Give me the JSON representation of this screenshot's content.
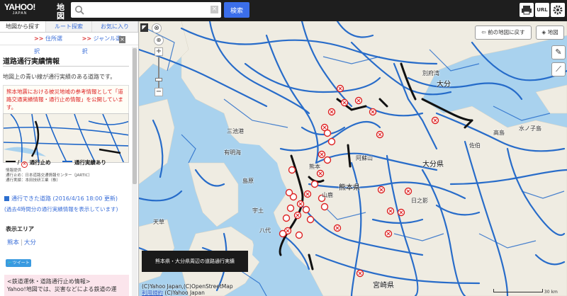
{
  "app": {
    "logo": "YAHOO!",
    "logo_sub": "JAPAN",
    "logo_service": "地図"
  },
  "search": {
    "value": "",
    "placeholder": "",
    "button_label": "検索"
  },
  "topbar_icons": [
    "print-icon",
    "url-icon",
    "settings-icon"
  ],
  "topbar_url_label": "URL",
  "tabs": [
    {
      "label": "地図から探す",
      "active": true
    },
    {
      "label": "ルート探索",
      "active": false
    },
    {
      "label": "お気に入り",
      "active": false
    }
  ],
  "subnav": {
    "arrow": ">>",
    "address": "住所選択",
    "genre": "ジャンル選択",
    "close": "×"
  },
  "panel": {
    "title": "道路通行実績情報",
    "intro": "地図上の青い線が通行実績のある道路です。",
    "notice": "熊本地震における被災地域の参考情報として「道路交通実績情報・通行止め情報」を公開しています。",
    "legend_closed": "通行止め",
    "legend_passable": "通行実績あり",
    "legend_slash": "/",
    "credits_header": "情報提供",
    "credits_closed": "通行止め：日本道路交通情報センター（JARTIC）",
    "credits_passable": "通行実績：本田技研工業（株）",
    "passable_link": "通行できた道路 (2016/4/16 18:00 更新)",
    "passable_sub": "(過去4時間分の通行実績情報を表示しています)",
    "area_label": "表示エリア",
    "areas": [
      "熊本",
      "大分"
    ],
    "tweet": "ツイート",
    "rail_title": "<鉄道運休・道路通行止め情報>",
    "rail_text": "Yahoo!地図では、災害などによる鉄道の運"
  },
  "map": {
    "prev_map": "前の地図に戻す",
    "layers": "地図",
    "zoom_in": "+",
    "zoom_out": "−",
    "caption": "熊本県・大分県周辺の道路通行実績",
    "copyright": "(C)Yahoo Japan,(C)OpenStreetMap",
    "terms_link": "利用規約",
    "copyright2": "(C)Yahoo Japan",
    "scale": "30 km",
    "places": [
      {
        "name": "大分",
        "big": true
      },
      {
        "name": "熊本県",
        "big": true
      },
      {
        "name": "大分県",
        "big": true
      },
      {
        "name": "宮崎県",
        "big": true
      },
      {
        "name": "別府湾"
      },
      {
        "name": "三池港"
      },
      {
        "name": "有明海"
      },
      {
        "name": "島原"
      },
      {
        "name": "熊本"
      },
      {
        "name": "阿蘇山"
      },
      {
        "name": "日之影"
      },
      {
        "name": "水ノ子島"
      },
      {
        "name": "高島"
      },
      {
        "name": "天草"
      },
      {
        "name": "佐伯"
      },
      {
        "name": "宇土"
      },
      {
        "name": "山鹿"
      },
      {
        "name": "八代"
      }
    ]
  },
  "colors": {
    "road": "#1e66c8",
    "closed": "#d22",
    "closed_road": "#111",
    "sea": "#a9d2ee",
    "land": "#efece2"
  }
}
